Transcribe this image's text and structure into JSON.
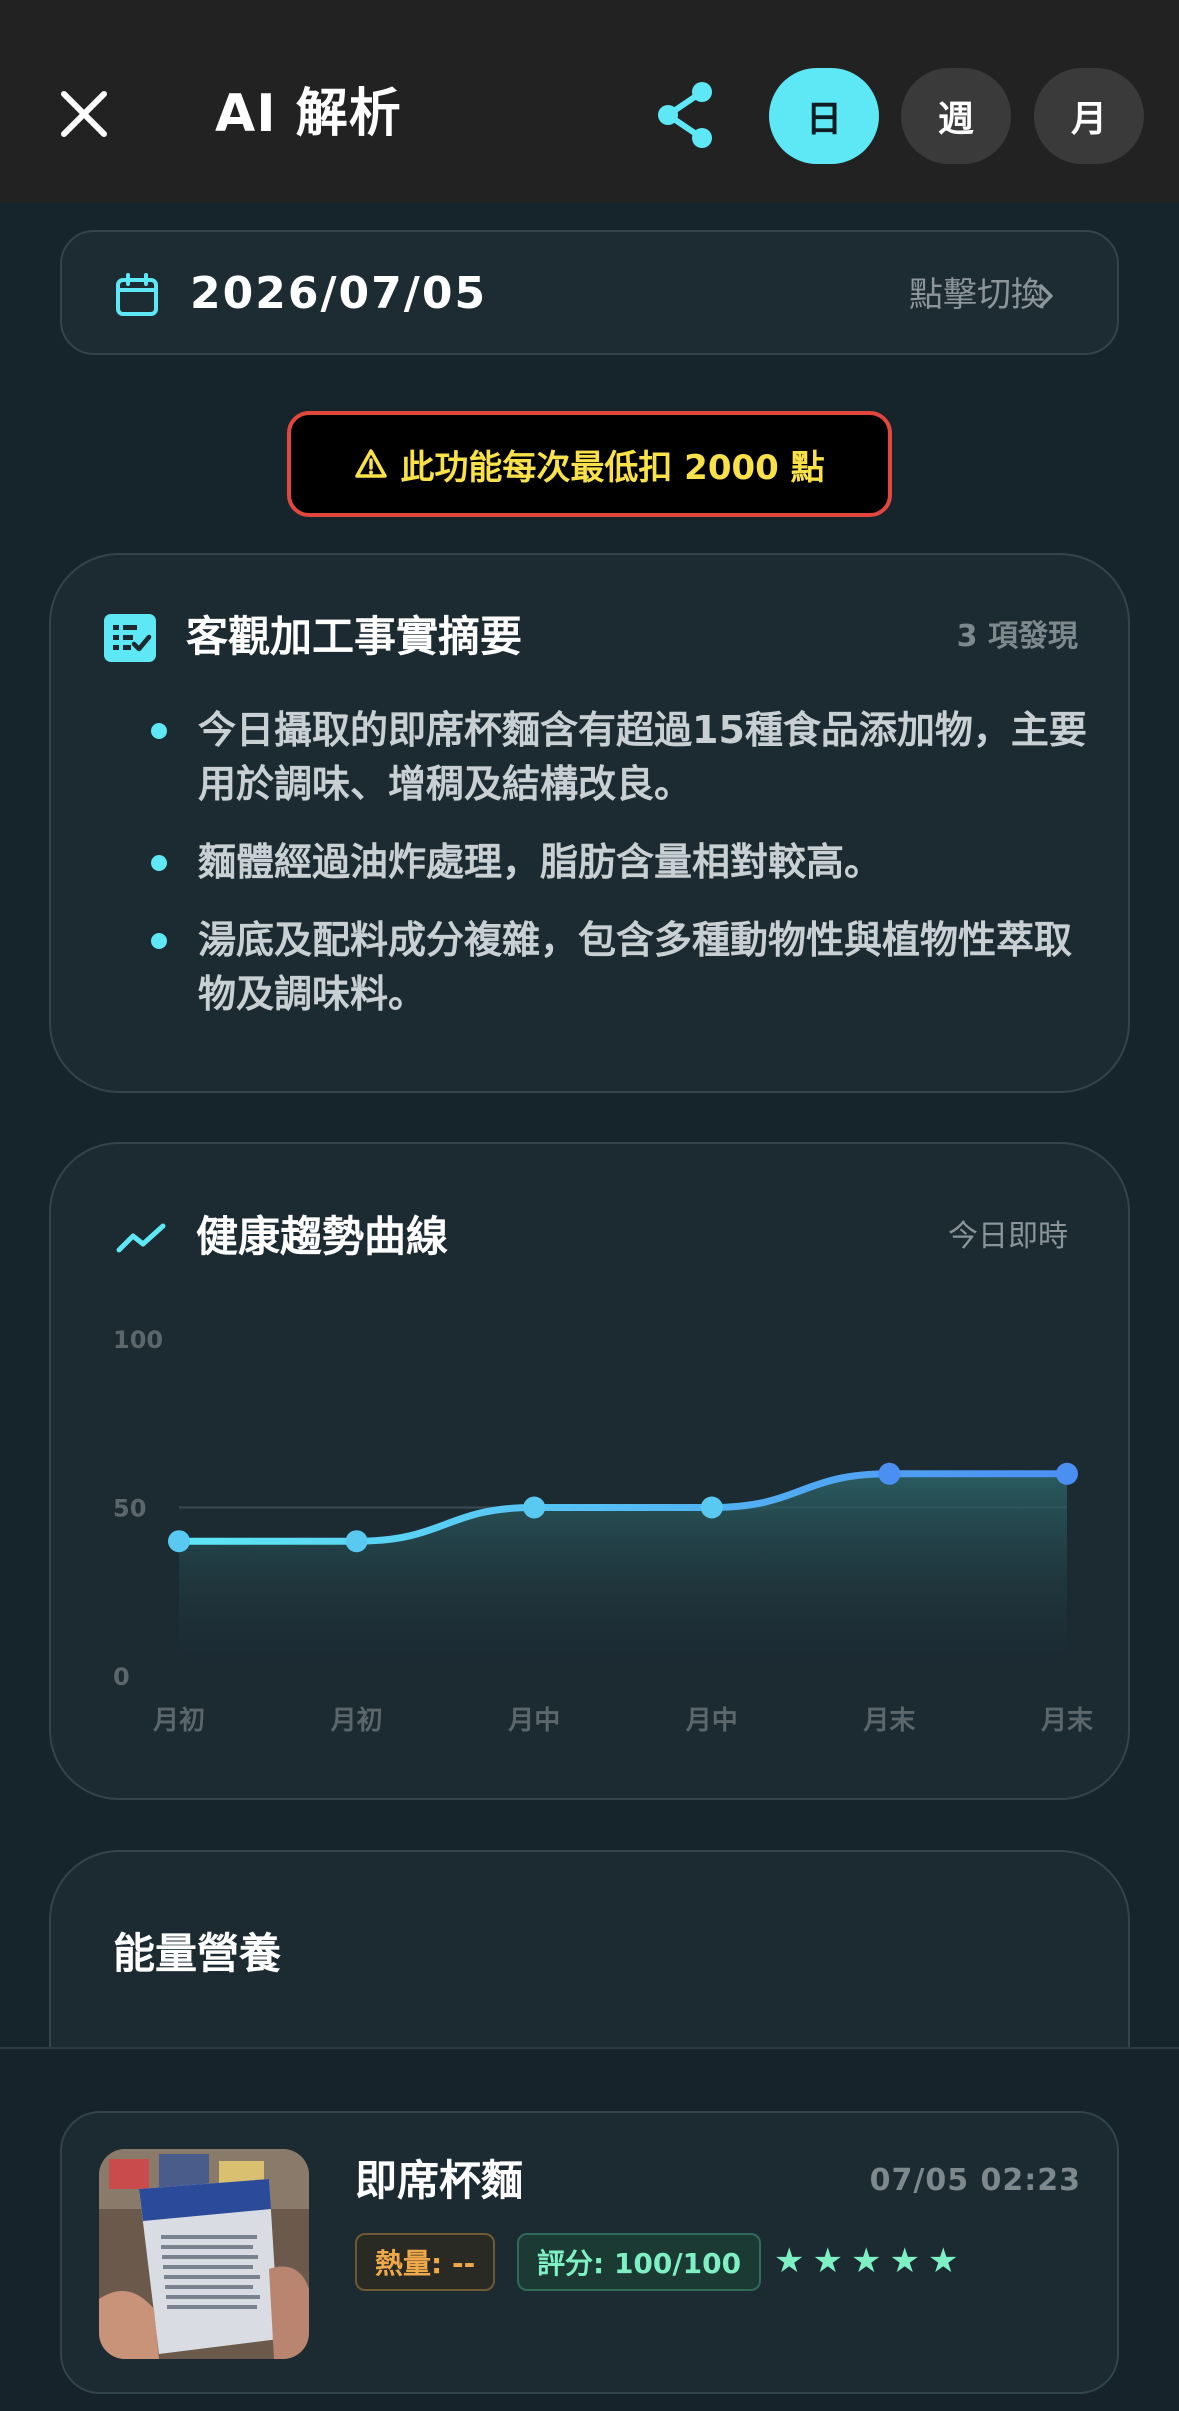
{
  "header": {
    "title": "AI 解析",
    "segments": [
      {
        "label": "日",
        "active": true
      },
      {
        "label": "週",
        "active": false
      },
      {
        "label": "月",
        "active": false
      }
    ]
  },
  "date_picker": {
    "date": "2026/07/05",
    "switch_label": "點擊切換"
  },
  "warning": {
    "text": "此功能每次最低扣 2000 點"
  },
  "summary": {
    "title": "客觀加工事實摘要",
    "count": "3 項發現",
    "items": [
      "今日攝取的即席杯麵含有超過15種食品添加物，主要用於調味、增稠及結構改良。",
      "麵體經過油炸處理，脂肪含量相對較高。",
      "湯底及配料成分複雜，包含多種動物性與植物性萃取物及調味料。"
    ]
  },
  "trend": {
    "title": "健康趨勢曲線",
    "note": "今日即時"
  },
  "chart_data": {
    "type": "area",
    "title": "",
    "categories": [
      "月初",
      "月初",
      "月中",
      "月中",
      "月末",
      "月末"
    ],
    "series": [
      {
        "values": [
          40,
          40,
          50,
          50,
          60,
          60
        ]
      }
    ],
    "y_ticks": [
      "100",
      "50",
      "0"
    ],
    "ylim": [
      0,
      100
    ],
    "grid": true,
    "line_color": "#5ee8f5",
    "line_color_end": "#4b8ff2"
  },
  "energy": {
    "title": "能量營養"
  },
  "food_entry": {
    "name": "即席杯麵",
    "time": "07/05 02:23",
    "calorie_badge": "熱量: --",
    "score_badge": "評分: 100/100",
    "stars": [
      "★",
      "★",
      "★",
      "★",
      "★"
    ]
  },
  "colors": {
    "accent": "#5ee8f5",
    "warning_border": "#e2473f",
    "warning_text": "#f9e14a"
  }
}
